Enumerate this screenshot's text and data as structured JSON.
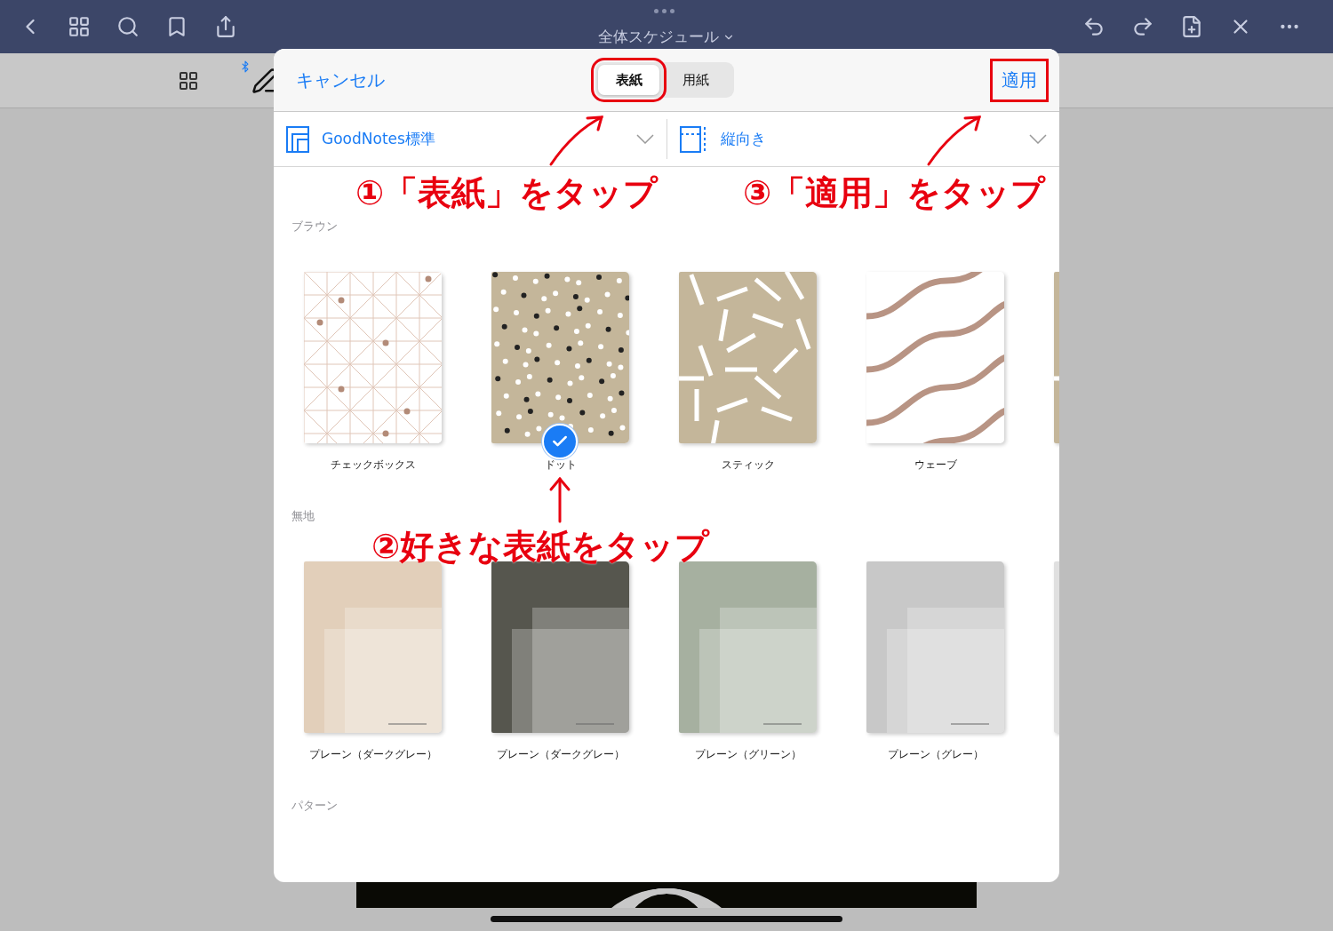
{
  "top_bar": {
    "title": "全体スケジュール"
  },
  "modal": {
    "cancel": "キャンセル",
    "tabs": [
      {
        "label": "表紙",
        "selected": true,
        "annotated": true
      },
      {
        "label": "用紙",
        "selected": false,
        "annotated": false
      }
    ],
    "apply": {
      "label": "適用",
      "annotated": true
    },
    "options": [
      {
        "label": "GoodNotes標準",
        "kind": "template"
      },
      {
        "label": "縦向き",
        "kind": "orientation"
      }
    ],
    "sections": [
      {
        "title": "ブラウン",
        "covers": [
          {
            "label": "チェックボックス",
            "kind": "checks",
            "selected": false
          },
          {
            "label": "ドット",
            "kind": "dots",
            "selected": true
          },
          {
            "label": "スティック",
            "kind": "sticks",
            "selected": false
          },
          {
            "label": "ウェーブ",
            "kind": "waves",
            "selected": false
          },
          {
            "kind": "sticks"
          }
        ]
      },
      {
        "title": "無地",
        "covers": [
          {
            "label": "プレーン（ダークグレー）",
            "kind": "plain",
            "color": "#e2cfba",
            "selected": false
          },
          {
            "label": "プレーン（ダークグレー）",
            "kind": "plain",
            "color": "#56564e",
            "selected": false
          },
          {
            "label": "プレーン（グリーン）",
            "kind": "plain",
            "color": "#a6b0a0",
            "selected": false
          },
          {
            "label": "プレーン（グレー）",
            "kind": "plain",
            "color": "#c8c8c8",
            "selected": false
          },
          {
            "kind": "plain",
            "color": "#e0e0e0"
          }
        ]
      },
      {
        "title": "パターン"
      }
    ]
  },
  "annotations": [
    {
      "text": "①「表紙」をタップ",
      "kind": "tabs"
    },
    {
      "text": "③「適用」をタップ",
      "kind": "apply"
    },
    {
      "text": "②好きな表紙をタップ",
      "kind": "cover"
    }
  ]
}
